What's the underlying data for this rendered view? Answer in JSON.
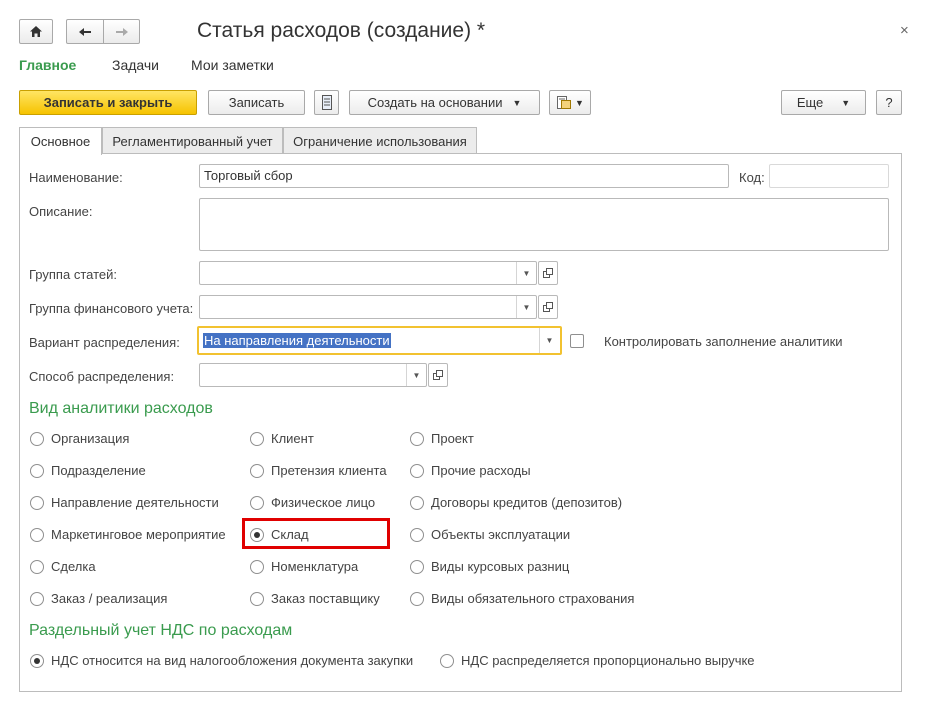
{
  "header": {
    "title": "Статья расходов (создание) *",
    "close_symbol": "×"
  },
  "nav": {
    "home_icon": "home-icon",
    "back_icon": "arrow-left-icon",
    "forward_icon": "arrow-right-icon"
  },
  "sections": [
    "Главное",
    "Задачи",
    "Мои заметки"
  ],
  "toolbar": {
    "save_close": "Записать и закрыть",
    "save": "Записать",
    "create_based": "Создать на основании",
    "more": "Еще",
    "help": "?"
  },
  "tabs": [
    "Основное",
    "Регламентированный учет",
    "Ограничение использования"
  ],
  "form": {
    "name_label": "Наименование:",
    "name_value": "Торговый сбор",
    "code_label": "Код:",
    "code_value": "",
    "description_label": "Описание:",
    "description_value": "",
    "group_label": "Группа статей:",
    "group_value": "",
    "fin_group_label": "Группа финансового учета:",
    "fin_group_value": "",
    "variant_label": "Вариант распределения:",
    "variant_value": "На направления деятельности",
    "control_label": "Контролировать заполнение аналитики",
    "control_checked": false,
    "method_label": "Способ распределения:",
    "method_value": ""
  },
  "analytics": {
    "title": "Вид аналитики расходов",
    "col1": [
      "Организация",
      "Подразделение",
      "Направление деятельности",
      "Маркетинговое мероприятие",
      "Сделка",
      "Заказ / реализация"
    ],
    "col2": [
      "Клиент",
      "Претензия клиента",
      "Физическое лицо",
      "Склад",
      "Номенклатура",
      "Заказ поставщику"
    ],
    "col3": [
      "Проект",
      "Прочие расходы",
      "Договоры кредитов (депозитов)",
      "Объекты эксплуатации",
      "Виды курсовых разниц",
      "Виды обязательного страхования"
    ],
    "selected": "Склад"
  },
  "vat": {
    "title": "Раздельный учет НДС по расходам",
    "option1": "НДС относится на вид налогообложения документа закупки",
    "option2": "НДС распределяется пропорционально выручке",
    "selected": "option1"
  },
  "colors": {
    "accent_green": "#3a9b4e",
    "primary_button": "#f6c300",
    "highlight_frame": "#e00000",
    "selection": "#4472c4"
  }
}
